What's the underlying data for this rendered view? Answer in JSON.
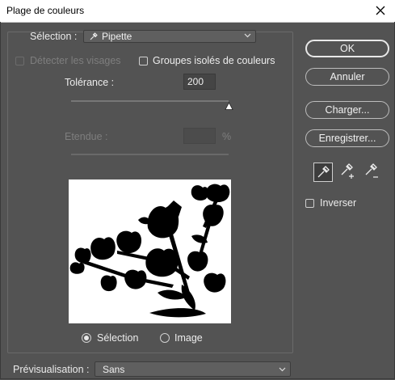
{
  "window": {
    "title": "Plage de couleurs"
  },
  "selection": {
    "label": "Sélection :",
    "value": "Pipette"
  },
  "options": {
    "detect_faces": {
      "label": "Détecter les visages",
      "checked": false,
      "enabled": false
    },
    "localized_clusters": {
      "label": "Groupes isolés de couleurs",
      "checked": false,
      "enabled": true
    }
  },
  "tolerance": {
    "label": "Tolérance :",
    "value": "200",
    "slider_fraction": 1.0
  },
  "range": {
    "label": "Etendue :",
    "value": "",
    "unit": "%",
    "enabled": false
  },
  "preview_mode": {
    "options": [
      {
        "label": "Sélection",
        "selected": true
      },
      {
        "label": "Image",
        "selected": false
      }
    ]
  },
  "buttons": {
    "ok": "OK",
    "cancel": "Annuler",
    "load": "Charger...",
    "save": "Enregistrer..."
  },
  "eyedroppers": [
    {
      "icon": "eyedropper-icon",
      "active": true
    },
    {
      "icon": "eyedropper-plus-icon",
      "active": false
    },
    {
      "icon": "eyedropper-minus-icon",
      "active": false
    }
  ],
  "invert": {
    "label": "Inverser",
    "checked": false
  },
  "selection_preview": {
    "label": "Prévisualisation :",
    "value": "Sans"
  },
  "colors": {
    "background": "#535353",
    "preview_bg": "#ffffff",
    "mask": "#000000"
  }
}
